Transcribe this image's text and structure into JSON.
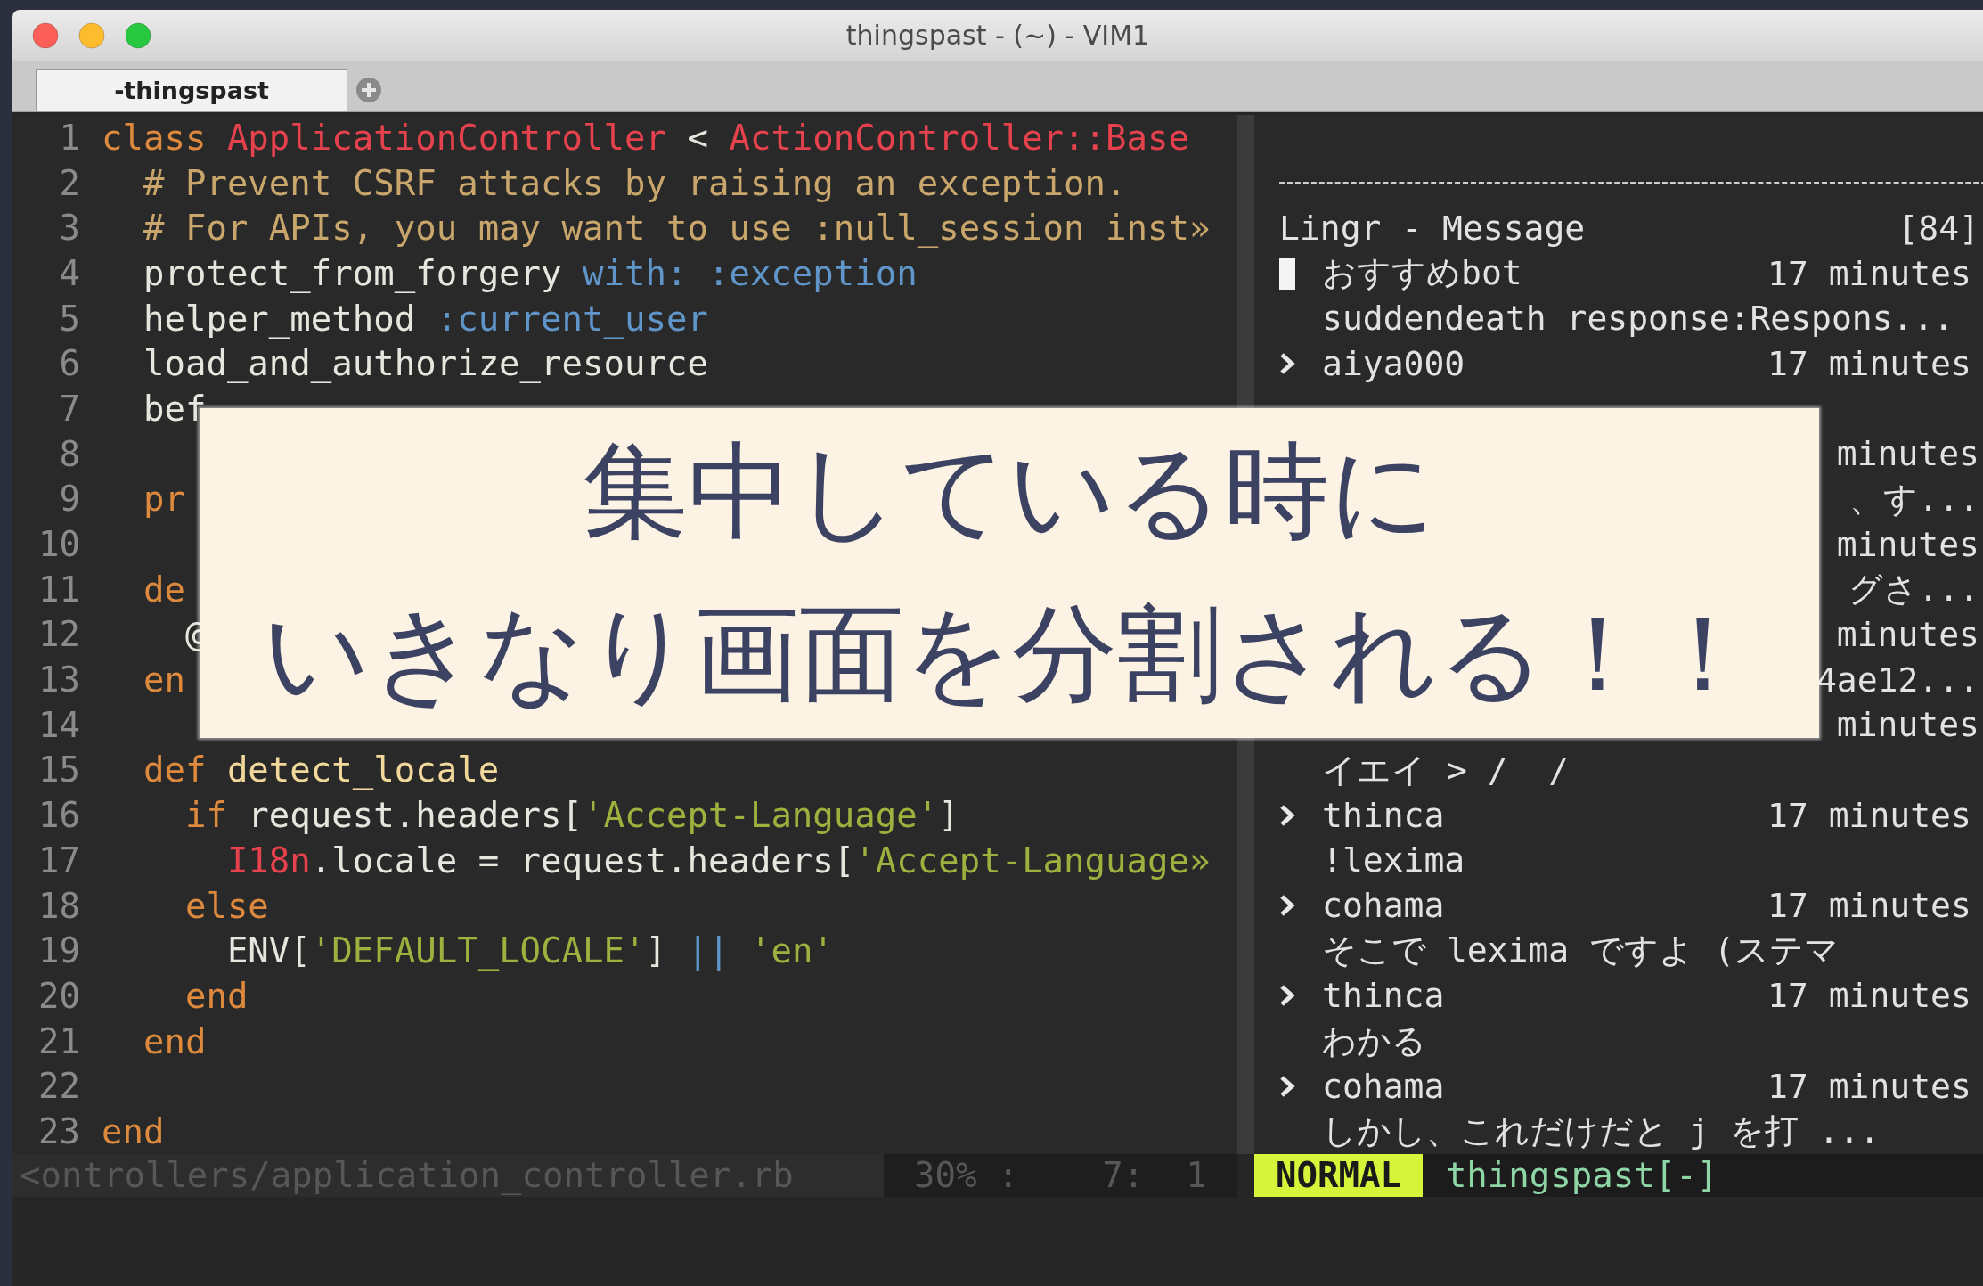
{
  "window": {
    "title": "thingspast - (~) - VIM1"
  },
  "tabs": [
    {
      "label": "-thingspast",
      "selected": true
    }
  ],
  "editor": {
    "lines": [
      {
        "number": "1",
        "tokens": [
          {
            "text": "class",
            "kind": "kw"
          },
          {
            "text": " ApplicationController",
            "kind": "const"
          },
          {
            "text": " < ",
            "kind": "plain"
          },
          {
            "text": "ActionController::Base",
            "kind": "const"
          }
        ]
      },
      {
        "number": "2",
        "tokens": [
          {
            "text": "  # Prevent CSRF attacks by raising an exception.",
            "kind": "comment"
          }
        ]
      },
      {
        "number": "3",
        "tokens": [
          {
            "text": "  # For APIs, you may want to use :null_session inst»",
            "kind": "comment"
          }
        ]
      },
      {
        "number": "4",
        "tokens": [
          {
            "text": "  protect_from_forgery ",
            "kind": "plain"
          },
          {
            "text": "with: :exception",
            "kind": "sym"
          }
        ]
      },
      {
        "number": "5",
        "tokens": [
          {
            "text": "  helper_method ",
            "kind": "plain"
          },
          {
            "text": ":current_user",
            "kind": "sym"
          }
        ]
      },
      {
        "number": "6",
        "tokens": [
          {
            "text": "  load_and_authorize_resource",
            "kind": "plain"
          }
        ]
      },
      {
        "number": "7",
        "tokens": [
          {
            "text": "  bef",
            "kind": "plain"
          }
        ]
      },
      {
        "number": "8"
      },
      {
        "number": "9",
        "tokens": [
          {
            "text": "  pr",
            "kind": "kw"
          }
        ]
      },
      {
        "number": "10"
      },
      {
        "number": "11",
        "tokens": [
          {
            "text": "  de",
            "kind": "kw"
          }
        ]
      },
      {
        "number": "12",
        "tokens": [
          {
            "text": "    @",
            "kind": "plain"
          }
        ]
      },
      {
        "number": "13",
        "tokens": [
          {
            "text": "  en",
            "kind": "kw"
          }
        ]
      },
      {
        "number": "14"
      },
      {
        "number": "15",
        "tokens": [
          {
            "text": "  def",
            "kind": "kw"
          },
          {
            "text": " detect_locale",
            "kind": "method"
          }
        ]
      },
      {
        "number": "16",
        "tokens": [
          {
            "text": "    if",
            "kind": "kw"
          },
          {
            "text": " request.headers[",
            "kind": "plain"
          },
          {
            "text": "'Accept-Language'",
            "kind": "str"
          },
          {
            "text": "]",
            "kind": "plain"
          }
        ]
      },
      {
        "number": "17",
        "tokens": [
          {
            "text": "      I18n",
            "kind": "const"
          },
          {
            "text": ".locale = request.headers[",
            "kind": "plain"
          },
          {
            "text": "'Accept-Language»",
            "kind": "str"
          }
        ]
      },
      {
        "number": "18",
        "tokens": [
          {
            "text": "    else",
            "kind": "kw"
          }
        ]
      },
      {
        "number": "19",
        "tokens": [
          {
            "text": "      ENV[",
            "kind": "plain"
          },
          {
            "text": "'DEFAULT_LOCALE'",
            "kind": "str"
          },
          {
            "text": "] ",
            "kind": "plain"
          },
          {
            "text": "||",
            "kind": "sym"
          },
          {
            "text": " 'en'",
            "kind": "str"
          }
        ]
      },
      {
        "number": "20",
        "tokens": [
          {
            "text": "    end",
            "kind": "kw"
          }
        ]
      },
      {
        "number": "21",
        "tokens": [
          {
            "text": "  end",
            "kind": "kw"
          }
        ]
      },
      {
        "number": "22"
      },
      {
        "number": "23",
        "tokens": [
          {
            "text": "end",
            "kind": "kw"
          }
        ]
      }
    ],
    "status": {
      "file": "<ontrollers/application_controller.rb",
      "position": "30% :    7:  1"
    }
  },
  "chat": {
    "rows": [
      {
        "kind": "blank"
      },
      {
        "kind": "rule"
      },
      {
        "kind": "header",
        "text": "Lingr - Message",
        "count": "[84]"
      },
      {
        "kind": "author",
        "name": "おすすめbot",
        "time": "17 minutes",
        "cursor": true
      },
      {
        "kind": "message",
        "text": "suddendeath response:Respons..."
      },
      {
        "kind": "author",
        "name": "aiya000",
        "time": "17 minutes",
        "cursor": false
      },
      {
        "kind": "blank"
      },
      {
        "kind": "tail",
        "text": "minutes"
      },
      {
        "kind": "tail",
        "text": "、す..."
      },
      {
        "kind": "tail",
        "text": "minutes"
      },
      {
        "kind": "tail",
        "text": "グさ..."
      },
      {
        "kind": "tail",
        "text": "minutes"
      },
      {
        "kind": "tail",
        "text": "4ae12..."
      },
      {
        "kind": "tail",
        "text": "minutes"
      },
      {
        "kind": "message",
        "text": "イエイ > /  /"
      },
      {
        "kind": "author",
        "name": "thinca",
        "time": "17 minutes",
        "cursor": false
      },
      {
        "kind": "message",
        "text": "!lexima"
      },
      {
        "kind": "author",
        "name": "cohama",
        "time": "17 minutes",
        "cursor": false
      },
      {
        "kind": "message",
        "text": "そこで lexima ですよ (ステマ"
      },
      {
        "kind": "author",
        "name": "thinca",
        "time": "17 minutes",
        "cursor": false
      },
      {
        "kind": "message",
        "text": "わかる"
      },
      {
        "kind": "author",
        "name": "cohama",
        "time": "17 minutes",
        "cursor": false
      },
      {
        "kind": "message",
        "text": "しかし、これだけだと j を打 ..."
      }
    ],
    "status": {
      "mode": "NORMAL",
      "buffer": "thingspast[-]"
    }
  },
  "caption": {
    "lines": [
      "集中している時に",
      "いきなり画面を分割される！！"
    ]
  }
}
